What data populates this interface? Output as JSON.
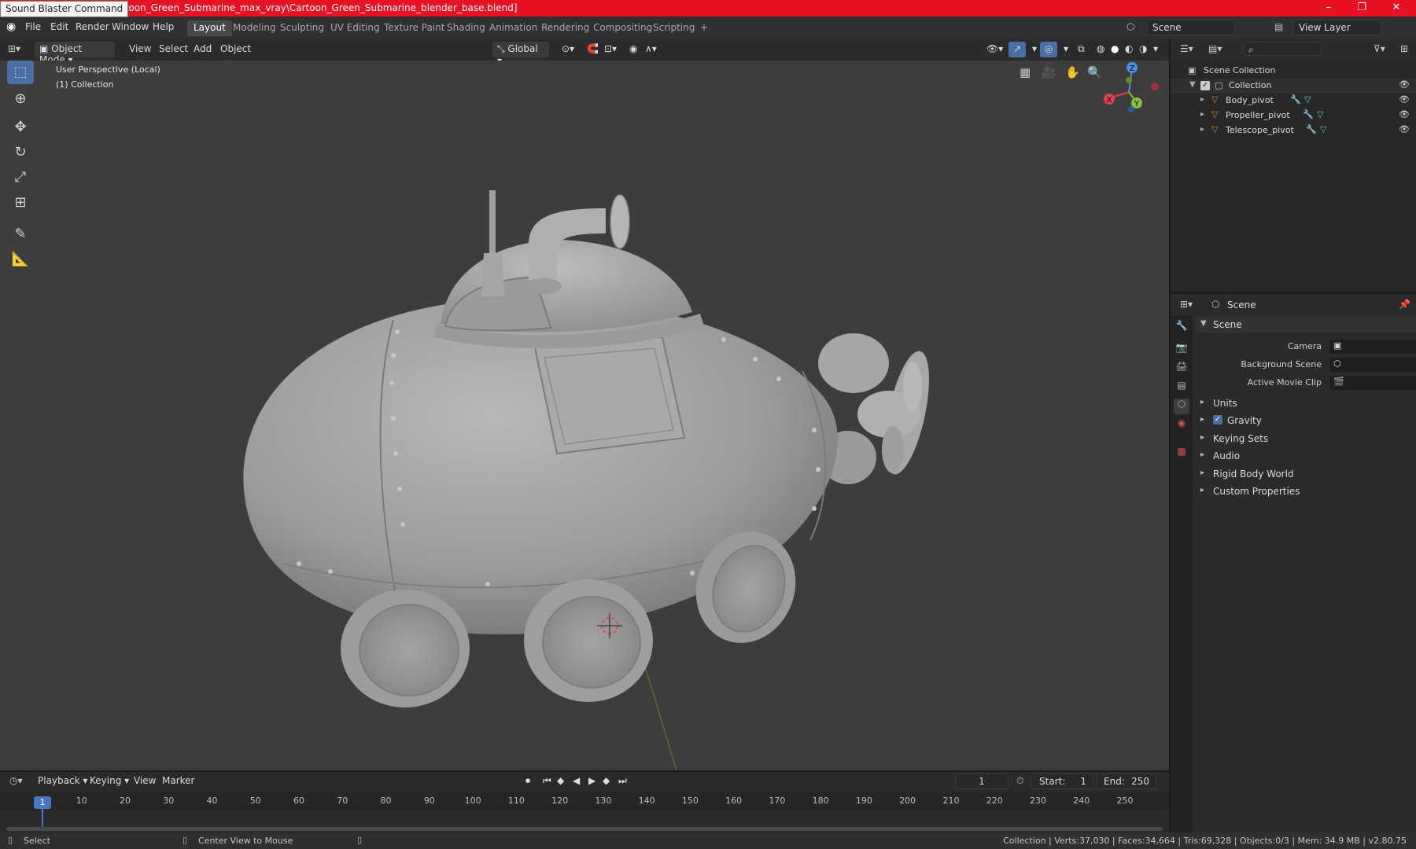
{
  "window": {
    "tooltip": "Sound Blaster Command",
    "title_path": "\\Cartoon_Green_Submarine_max_vray\\Cartoon_Green_Submarine_blender_base.blend]",
    "controls": [
      "–",
      "❐",
      "✕"
    ]
  },
  "menu": {
    "items": [
      "File",
      "Edit",
      "Render",
      "Window",
      "Help"
    ],
    "workspaces": [
      "Layout",
      "Modeling",
      "Sculpting",
      "UV Editing",
      "Texture Paint",
      "Shading",
      "Animation",
      "Rendering",
      "Compositing",
      "Scripting"
    ],
    "active_workspace": "Layout",
    "add_tab": "+",
    "scene_field": "Scene",
    "view_layer_field": "View Layer"
  },
  "viewport_header": {
    "mode": "Object Mode",
    "menus": [
      "View",
      "Select",
      "Add",
      "Object"
    ],
    "transform_orientation": "Global"
  },
  "viewport": {
    "perspective_label": "User Perspective (Local)",
    "collection_label": "(1) Collection",
    "gizmo": {
      "x": "X",
      "y": "Y",
      "z": "Z"
    }
  },
  "outliner": {
    "root": "Scene Collection",
    "collection": "Collection",
    "objects": [
      "Body_pivot",
      "Propeller_pivot",
      "Telescope_pivot"
    ]
  },
  "properties": {
    "header": "Scene",
    "section": "Scene",
    "fields": [
      {
        "label": "Camera"
      },
      {
        "label": "Background Scene"
      },
      {
        "label": "Active Movie Clip"
      }
    ],
    "panels": [
      "Units",
      "Gravity",
      "Keying Sets",
      "Audio",
      "Rigid Body World",
      "Custom Properties"
    ],
    "gravity_checked": true
  },
  "timeline": {
    "menus": [
      "Playback",
      "Keying",
      "View",
      "Marker"
    ],
    "current_frame": "1",
    "start_label": "Start:",
    "start_value": "1",
    "end_label": "End:",
    "end_value": "250",
    "ticks": [
      "1",
      "10",
      "20",
      "30",
      "40",
      "50",
      "60",
      "70",
      "80",
      "90",
      "100",
      "110",
      "120",
      "130",
      "140",
      "150",
      "160",
      "170",
      "180",
      "190",
      "200",
      "210",
      "220",
      "230",
      "240",
      "250"
    ]
  },
  "statusbar": {
    "left_action": "Select",
    "middle_action": "Center View to Mouse",
    "stats": "Collection | Verts:37,030 | Faces:34,664 | Tris:69,328 | Objects:0/3 | Mem: 34.9 MB | v2.80.75"
  },
  "colors": {
    "titlebar": "#e81123",
    "accent": "#4a6fa5",
    "viewport_bg": "#3d3d3d",
    "object_orange": "#e08a35",
    "modifier_blue": "#5aa2e0",
    "mesh_green": "#4fd1a0"
  }
}
